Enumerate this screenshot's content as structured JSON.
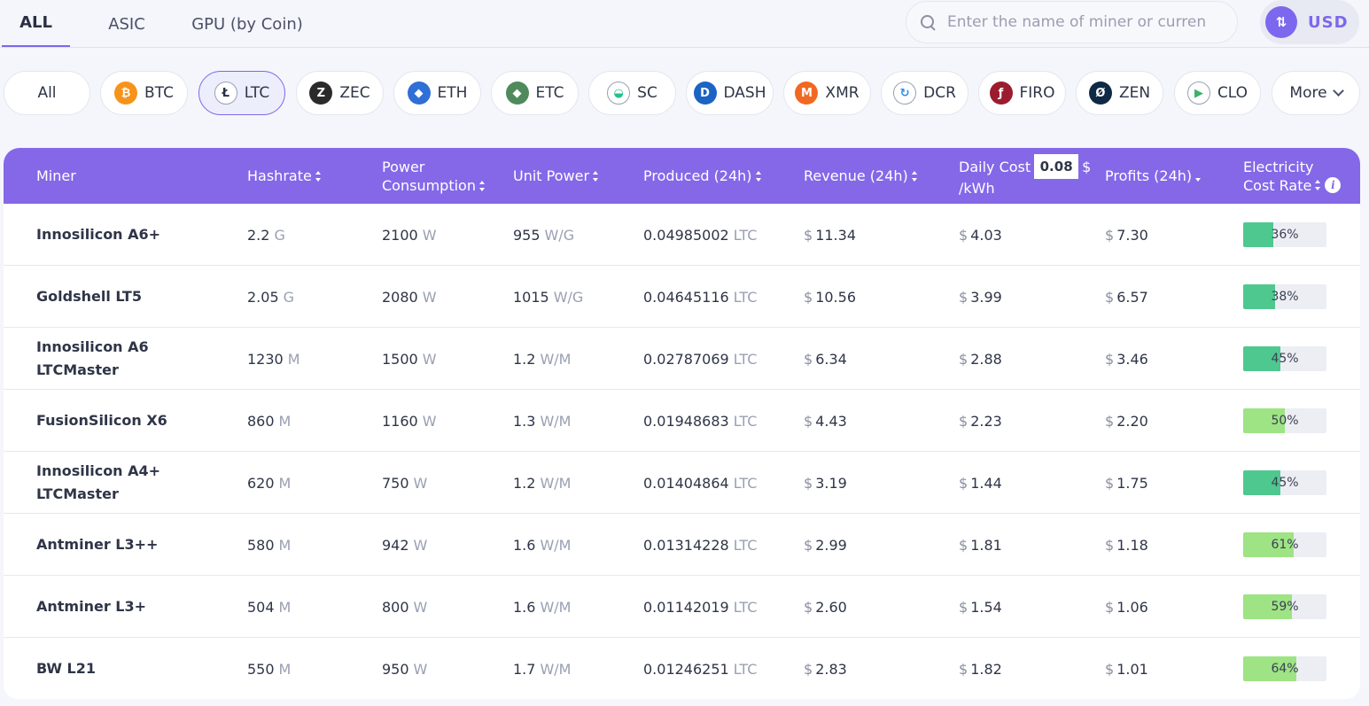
{
  "tabs": [
    {
      "label": "ALL",
      "active": true
    },
    {
      "label": "ASIC",
      "active": false
    },
    {
      "label": "GPU (by Coin)",
      "active": false
    }
  ],
  "search": {
    "placeholder": "Enter the name of miner or curren"
  },
  "currency": {
    "label": "USD",
    "icon": "swap-icon"
  },
  "coins": [
    {
      "label": "All",
      "icon": "",
      "color": ""
    },
    {
      "label": "BTC",
      "icon": "bitcoin-icon",
      "color": "#f7931a",
      "glyph": "₿"
    },
    {
      "label": "LTC",
      "icon": "litecoin-icon",
      "color": "#ffffff",
      "glyph": "Ł",
      "active": true
    },
    {
      "label": "ZEC",
      "icon": "zcash-icon",
      "color": "#2b2b2b",
      "glyph": "Z"
    },
    {
      "label": "ETH",
      "icon": "ethereum-icon",
      "color": "#2f6fd6",
      "glyph": "◆"
    },
    {
      "label": "ETC",
      "icon": "ethereum-classic-icon",
      "color": "#4f8a5c",
      "glyph": "◆"
    },
    {
      "label": "SC",
      "icon": "siacoin-icon",
      "color": "#ffffff",
      "glyph": "◒"
    },
    {
      "label": "DASH",
      "icon": "dash-icon",
      "color": "#1c64c4",
      "glyph": "D"
    },
    {
      "label": "XMR",
      "icon": "monero-icon",
      "color": "#f26822",
      "glyph": "M"
    },
    {
      "label": "DCR",
      "icon": "decred-icon",
      "color": "#ffffff",
      "glyph": "↻"
    },
    {
      "label": "FIRO",
      "icon": "firo-icon",
      "color": "#9b1c2e",
      "glyph": "ƒ"
    },
    {
      "label": "ZEN",
      "icon": "horizen-icon",
      "color": "#0e2a45",
      "glyph": "Ø"
    },
    {
      "label": "CLO",
      "icon": "callisto-icon",
      "color": "#ffffff",
      "glyph": "▶"
    },
    {
      "label": "More",
      "icon": "chevron-down-icon",
      "color": ""
    }
  ],
  "table": {
    "headers": {
      "miner": "Miner",
      "hashrate": "Hashrate",
      "power_line1": "Power",
      "power_line2": "Consumption",
      "unit_power": "Unit Power",
      "produced": "Produced (24h)",
      "revenue": "Revenue (24h)",
      "daily_cost_line1": "Daily Cost",
      "daily_cost_value": "0.08",
      "daily_cost_dollar": "$",
      "daily_cost_line2": "/kWh",
      "profits": "Profits (24h)",
      "elec_line1": "Electricity",
      "elec_line2": "Cost Rate",
      "info": "i"
    },
    "currency_symbol": "$",
    "bar_colors": {
      "dark": "#4fc88f",
      "light": "#9ee384"
    },
    "rows": [
      {
        "name": "Innosilicon A6+",
        "hashrate": "2.2",
        "hash_unit": "G",
        "power": "2100",
        "power_unit": "W",
        "unit_power": "955",
        "unit_power_unit": "W/G",
        "produced": "0.04985002",
        "produced_unit": "LTC",
        "revenue": "11.34",
        "cost": "4.03",
        "profit": "7.30",
        "rate_label": "36%",
        "rate": 36,
        "shade": "dark"
      },
      {
        "name": "Goldshell LT5",
        "hashrate": "2.05",
        "hash_unit": "G",
        "power": "2080",
        "power_unit": "W",
        "unit_power": "1015",
        "unit_power_unit": "W/G",
        "produced": "0.04645116",
        "produced_unit": "LTC",
        "revenue": "10.56",
        "cost": "3.99",
        "profit": "6.57",
        "rate_label": "38%",
        "rate": 38,
        "shade": "dark"
      },
      {
        "name": "Innosilicon A6 LTCMaster",
        "hashrate": "1230",
        "hash_unit": "M",
        "power": "1500",
        "power_unit": "W",
        "unit_power": "1.2",
        "unit_power_unit": "W/M",
        "produced": "0.02787069",
        "produced_unit": "LTC",
        "revenue": "6.34",
        "cost": "2.88",
        "profit": "3.46",
        "rate_label": "45%",
        "rate": 45,
        "shade": "dark"
      },
      {
        "name": "FusionSilicon X6",
        "hashrate": "860",
        "hash_unit": "M",
        "power": "1160",
        "power_unit": "W",
        "unit_power": "1.3",
        "unit_power_unit": "W/M",
        "produced": "0.01948683",
        "produced_unit": "LTC",
        "revenue": "4.43",
        "cost": "2.23",
        "profit": "2.20",
        "rate_label": "50%",
        "rate": 50,
        "shade": "light"
      },
      {
        "name": "Innosilicon A4+ LTCMaster",
        "hashrate": "620",
        "hash_unit": "M",
        "power": "750",
        "power_unit": "W",
        "unit_power": "1.2",
        "unit_power_unit": "W/M",
        "produced": "0.01404864",
        "produced_unit": "LTC",
        "revenue": "3.19",
        "cost": "1.44",
        "profit": "1.75",
        "rate_label": "45%",
        "rate": 45,
        "shade": "dark"
      },
      {
        "name": "Antminer L3++",
        "hashrate": "580",
        "hash_unit": "M",
        "power": "942",
        "power_unit": "W",
        "unit_power": "1.6",
        "unit_power_unit": "W/M",
        "produced": "0.01314228",
        "produced_unit": "LTC",
        "revenue": "2.99",
        "cost": "1.81",
        "profit": "1.18",
        "rate_label": "61%",
        "rate": 61,
        "shade": "light"
      },
      {
        "name": "Antminer L3+",
        "hashrate": "504",
        "hash_unit": "M",
        "power": "800",
        "power_unit": "W",
        "unit_power": "1.6",
        "unit_power_unit": "W/M",
        "produced": "0.01142019",
        "produced_unit": "LTC",
        "revenue": "2.60",
        "cost": "1.54",
        "profit": "1.06",
        "rate_label": "59%",
        "rate": 59,
        "shade": "light"
      },
      {
        "name": "BW L21",
        "hashrate": "550",
        "hash_unit": "M",
        "power": "950",
        "power_unit": "W",
        "unit_power": "1.7",
        "unit_power_unit": "W/M",
        "produced": "0.01246251",
        "produced_unit": "LTC",
        "revenue": "2.83",
        "cost": "1.82",
        "profit": "1.01",
        "rate_label": "64%",
        "rate": 64,
        "shade": "light"
      }
    ]
  }
}
